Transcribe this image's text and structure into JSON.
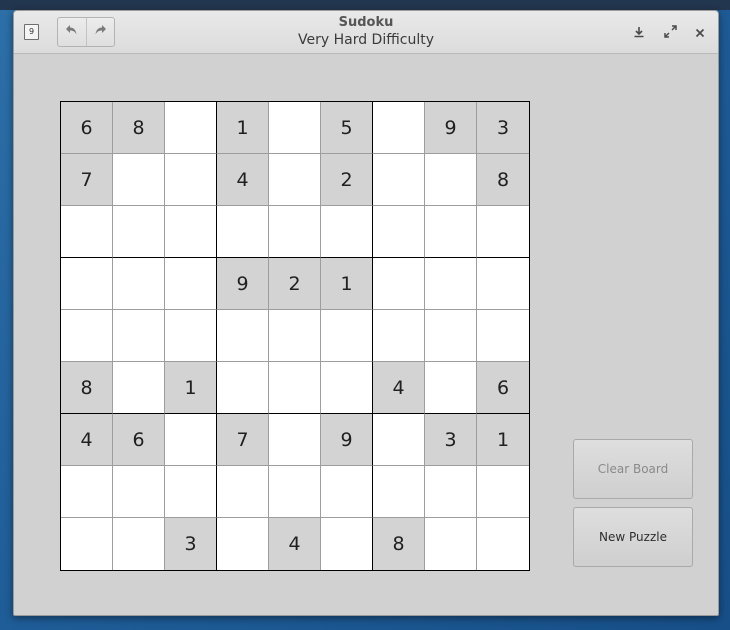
{
  "window": {
    "title": "Sudoku",
    "subtitle": "Very Hard Difficulty",
    "app_icon_glyph": "9"
  },
  "toolbar": {
    "undo_icon": "undo-icon",
    "redo_icon": "redo-icon"
  },
  "window_controls": [
    "download-icon",
    "maximize-icon",
    "close-icon"
  ],
  "board": {
    "rows": [
      [
        "6",
        "8",
        "",
        "1",
        "",
        "5",
        "",
        "9",
        "3"
      ],
      [
        "7",
        "",
        "",
        "4",
        "",
        "2",
        "",
        "",
        "8"
      ],
      [
        "",
        "",
        "",
        "",
        "",
        "",
        "",
        "",
        ""
      ],
      [
        "",
        "",
        "",
        "9",
        "2",
        "1",
        "",
        "",
        ""
      ],
      [
        "",
        "",
        "",
        "",
        "",
        "",
        "",
        "",
        ""
      ],
      [
        "8",
        "",
        "1",
        "",
        "",
        "",
        "4",
        "",
        "6"
      ],
      [
        "4",
        "6",
        "",
        "7",
        "",
        "9",
        "",
        "3",
        "1"
      ],
      [
        "",
        "",
        "",
        "",
        "",
        "",
        "",
        "",
        ""
      ],
      [
        "",
        "",
        "3",
        "",
        "4",
        "",
        "8",
        "",
        ""
      ]
    ]
  },
  "buttons": {
    "clear_label": "Clear Board",
    "new_puzzle_label": "New Puzzle"
  },
  "colors": {
    "given_cell": "#d3d3d3",
    "empty_cell": "#ffffff",
    "window_bg": "#d1d1d1"
  }
}
